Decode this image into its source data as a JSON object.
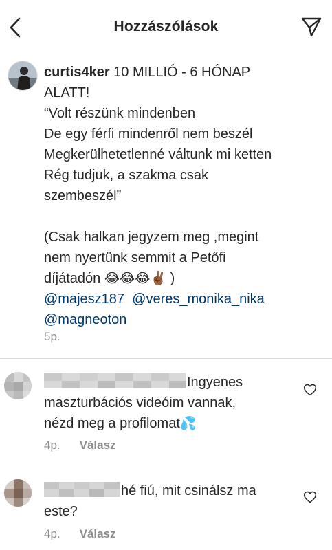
{
  "header": {
    "title": "Hozzászólások"
  },
  "caption": {
    "username": "curtis4ker",
    "first_line": " 10 MILLIÓ - 6 HÓNAP",
    "lines": [
      "ALATT!",
      "“Volt részünk mindenben",
      "De egy férfi mindenről nem beszél",
      "Megkerülhetetlenné váltunk mi ketten",
      "Rég tudjuk, a szakma csak",
      "szembeszél”"
    ],
    "note_lines": [
      "(Csak halkan jegyzem meg ,megint",
      "nem nyertünk semmit a Petőfi"
    ],
    "note_last": "díjátadón ",
    "emojis": "😂😂😂✌🏾",
    "note_close": " )",
    "mentions": [
      "@majesz187",
      "@veres_monika_nika",
      "@magneoton"
    ],
    "time": "5p."
  },
  "comments": [
    {
      "text_line1": "Ingyenes",
      "text_line2": "maszturbációs videóim vannak,",
      "text_line3": "nézd meg a profilomat",
      "emoji": "💦",
      "time": "4p.",
      "reply": "Válasz"
    },
    {
      "text_line1": "hé fiú, mit csinálsz ma",
      "text_line2": "este?",
      "time": "4p.",
      "reply": "Válasz"
    }
  ],
  "icons": {
    "back": "chevron-left-icon",
    "share": "paper-plane-icon",
    "like": "heart-outline-icon"
  }
}
